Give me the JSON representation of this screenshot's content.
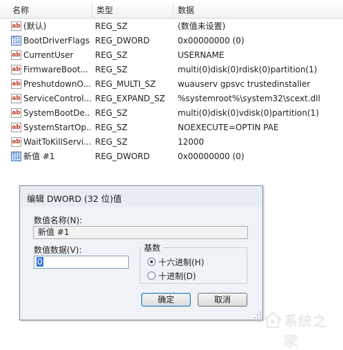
{
  "columns": {
    "name": "名称",
    "type": "类型",
    "data": "数据"
  },
  "rows": [
    {
      "icon": "string-value-icon",
      "name": "(默认)",
      "type": "REG_SZ",
      "data": "(数值未设置)"
    },
    {
      "icon": "binary-value-icon",
      "name": "BootDriverFlags",
      "type": "REG_DWORD",
      "data": "0x00000000 (0)"
    },
    {
      "icon": "string-value-icon",
      "name": "CurrentUser",
      "type": "REG_SZ",
      "data": "USERNAME"
    },
    {
      "icon": "string-value-icon",
      "name": "FirmwareBoot...",
      "type": "REG_SZ",
      "data": "multi(0)disk(0)rdisk(0)partition(1)"
    },
    {
      "icon": "string-value-icon",
      "name": "PreshutdownO...",
      "type": "REG_MULTI_SZ",
      "data": "wuauserv gpsvc trustedinstaller"
    },
    {
      "icon": "string-value-icon",
      "name": "ServiceControl...",
      "type": "REG_EXPAND_SZ",
      "data": "%systemroot%\\system32\\scext.dll"
    },
    {
      "icon": "string-value-icon",
      "name": "SystemBootDe...",
      "type": "REG_SZ",
      "data": "multi(0)disk(0)vdisk(0)partition(1)"
    },
    {
      "icon": "string-value-icon",
      "name": "SystemStartOp...",
      "type": "REG_SZ",
      "data": " NOEXECUTE=OPTIN  PAE"
    },
    {
      "icon": "string-value-icon",
      "name": "WaitToKillServi...",
      "type": "REG_SZ",
      "data": "12000"
    },
    {
      "icon": "binary-value-icon",
      "name": "新值 #1",
      "type": "REG_DWORD",
      "data": "0x00000000 (0)"
    }
  ],
  "dialog": {
    "title": "编辑 DWORD (32 位)值",
    "value_name_label": "数值名称(N):",
    "value_name": "新值 #1",
    "value_data_label": "数值数据(V):",
    "value_data": "0",
    "base_label": "基数",
    "hex_label": "十六进制(H)",
    "dec_label": "十进制(D)",
    "selected_base": "hex",
    "ok_label": "确定",
    "cancel_label": "取消"
  },
  "watermark": {
    "text": "系统之家"
  },
  "colors": {
    "accent": "#3875d7",
    "dialog_bg": "#eff2f6",
    "string_icon": "#c0392b",
    "binary_icon": "#2157a8"
  }
}
